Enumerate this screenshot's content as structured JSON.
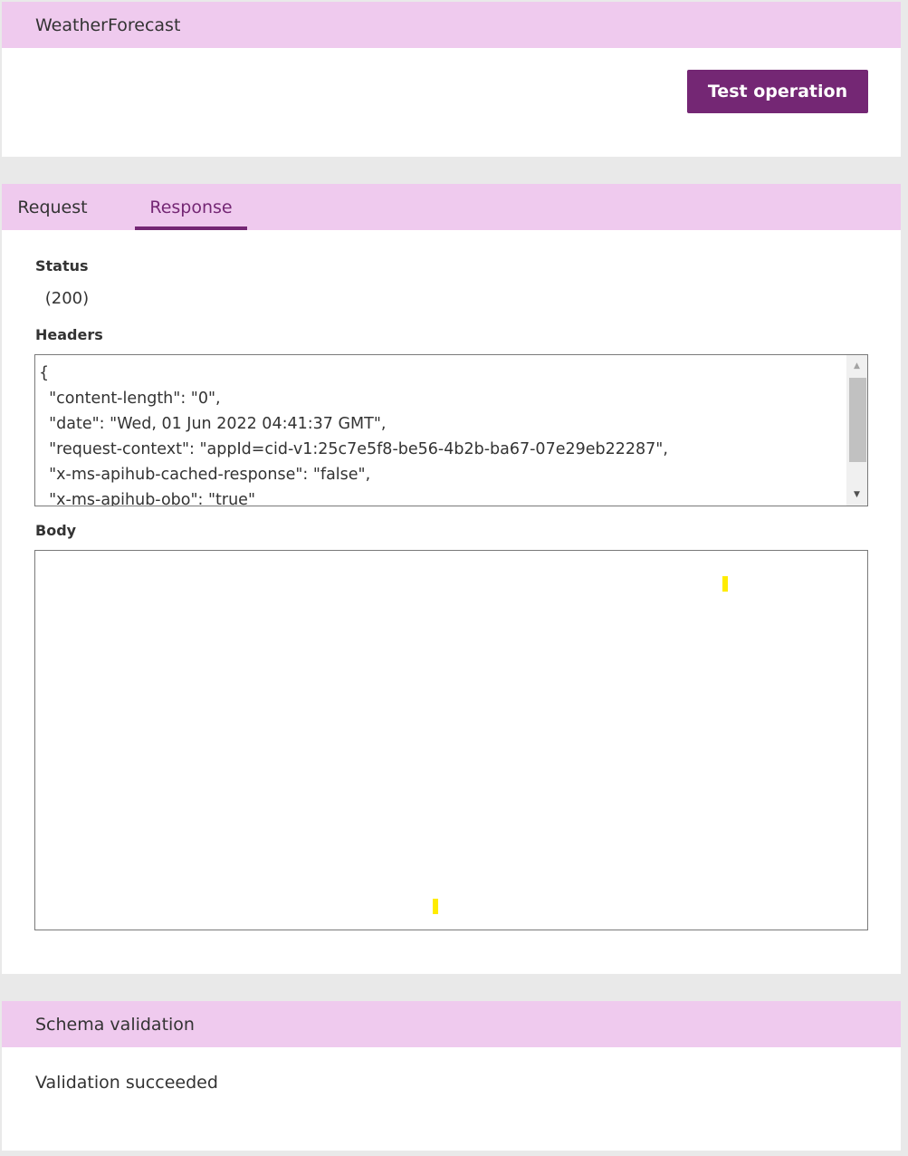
{
  "operation": {
    "title": "WeatherForecast",
    "test_button_label": "Test operation",
    "accent_color": "#742774",
    "header_color": "#efcaee"
  },
  "response_panel": {
    "tabs": [
      {
        "label": "Request",
        "active": false
      },
      {
        "label": "Response",
        "active": true
      }
    ],
    "status_label": "Status",
    "status_value": " (200)",
    "headers_label": "Headers",
    "headers_text": "{\n  \"content-length\": \"0\",\n  \"date\": \"Wed, 01 Jun 2022 04:41:37 GMT\",\n  \"request-context\": \"appId=cid-v1:25c7e5f8-be56-4b2b-ba67-07e29eb22287\",\n  \"x-ms-apihub-cached-response\": \"false\",\n  \"x-ms-apihub-obo\": \"true\"",
    "body_label": "Body",
    "body_text": ""
  },
  "schema": {
    "title": "Schema validation",
    "message": "Validation succeeded"
  }
}
